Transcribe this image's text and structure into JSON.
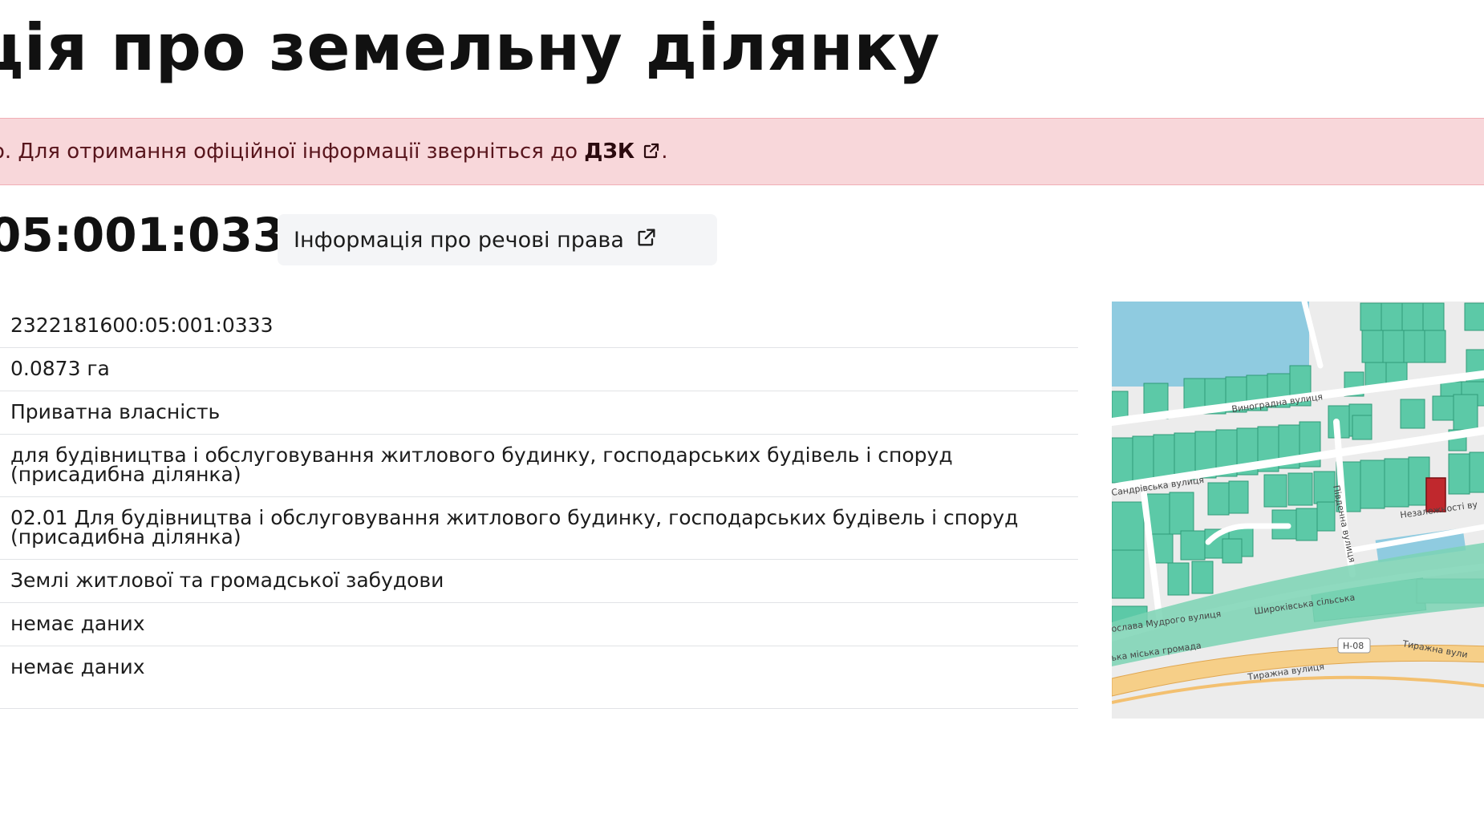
{
  "header": {
    "title": "ція про земельну ділянку"
  },
  "alert": {
    "text_before": "о. Для отримання офіційної інформації зверніться до ",
    "link_label": "ДЗК",
    "text_after": "."
  },
  "parcel": {
    "cadastral_number_heading": "05:001:0333",
    "rights_button_label": "Інформація про речові права"
  },
  "details": {
    "cadastral_number": "2322181600:05:001:0333",
    "area": "0.0873 га",
    "ownership": "Приватна власність",
    "purpose": "для будівництва і обслуговування житлового будинку, господарських будівель і споруд (присадибна ділянка)",
    "purpose_code": "02.01 Для будівництва і обслуговування житлового будинку, господарських будівель і споруд (присадибна ділянка)",
    "category": "Землі житлової та громадської забудови",
    "value_1": "немає даних",
    "value_2": "немає даних"
  },
  "map": {
    "labels": {
      "street_vynogradna": "Виноградна вулиця",
      "street_sandrivska": "Сандрівська вулиця",
      "street_pivdenna": "Південна вулиця",
      "street_nezalezhnosti": "Незалежності ву",
      "street_shyrokivska": "Широківська сільська",
      "street_yaroslava": "ослава Мудрого вулиця",
      "community": "ька міська громада",
      "road_code": "Н-08",
      "street_tyrazhna_1": "Тиражна вулиця",
      "street_tyrazhna_2": "Тиражна вули"
    },
    "colors": {
      "parcel": "#5cc9a7",
      "parcel_border": "#2f9a78",
      "water": "#8fcbe0",
      "road": "#ffffff",
      "highway": "#f6cf88",
      "selected": "#c0282d"
    }
  }
}
